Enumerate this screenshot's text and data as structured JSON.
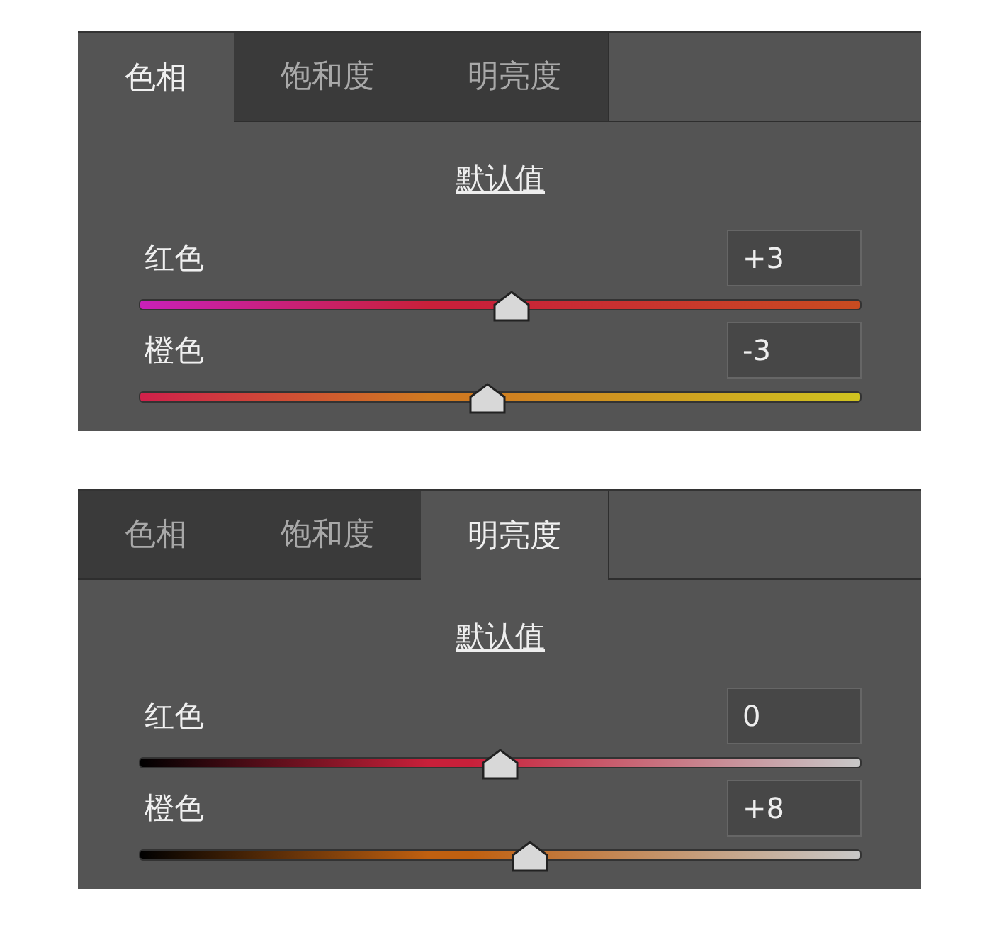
{
  "panels": [
    {
      "kind": "hue",
      "tabs": [
        {
          "label": "色相",
          "selected": true
        },
        {
          "label": "饱和度",
          "selected": false
        },
        {
          "label": "明亮度",
          "selected": false
        }
      ],
      "default_link": "默认值",
      "sliders": [
        {
          "name": "红色",
          "reading": "+3",
          "level": 0.516,
          "color": "#c8203a"
        },
        {
          "name": "橙色",
          "reading": "-3",
          "level": 0.482,
          "color": "#d07a20"
        }
      ]
    },
    {
      "kind": "luminance",
      "tabs": [
        {
          "label": "色相",
          "selected": false
        },
        {
          "label": "饱和度",
          "selected": false
        },
        {
          "label": "明亮度",
          "selected": true
        }
      ],
      "default_link": "默认值",
      "sliders": [
        {
          "name": "红色",
          "reading": "0",
          "level": 0.5,
          "color": "#c8203a"
        },
        {
          "name": "橙色",
          "reading": "+8",
          "level": 0.541,
          "color": "#c06010"
        }
      ]
    }
  ]
}
